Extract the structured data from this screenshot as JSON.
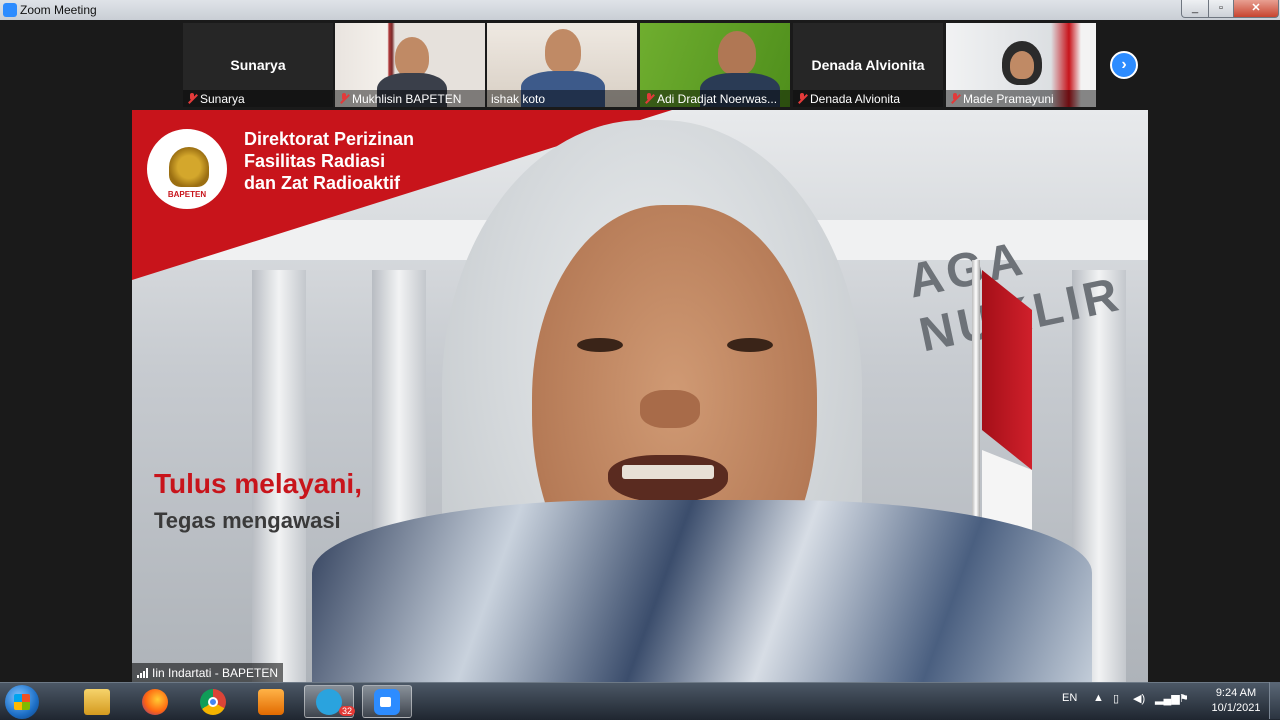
{
  "window": {
    "title": "Zoom Meeting",
    "minimize": "_",
    "maximize": "▫",
    "close": "✕"
  },
  "gallery": {
    "tiles": [
      {
        "name_center": "Sunarya",
        "caption": "Sunarya"
      },
      {
        "caption": "Mukhlisin BAPETEN"
      },
      {
        "caption": "ishak koto"
      },
      {
        "caption": "Adi Dradjat Noerwas..."
      },
      {
        "name_center": "Denada Alvionita",
        "caption": "Denada Alvionita"
      },
      {
        "caption": "Made Pramayuni"
      }
    ],
    "next_button": "›"
  },
  "main_video": {
    "banner_title_lines": [
      "Direktorat Perizinan",
      "Fasilitas Radiasi",
      "dan Zat Radioaktif"
    ],
    "logo_label": "BAPETEN",
    "slogan_line1": "Tulus melayani,",
    "slogan_line2": "Tegas mengawasi",
    "sign_text": "AGA NUKLIR",
    "speaker_name": "Iin Indartati - BAPETEN"
  },
  "taskbar": {
    "apps": [
      "explorer",
      "firefox",
      "chrome",
      "media-player",
      "telegram",
      "zoom"
    ],
    "telegram_badge": "32",
    "language": "EN",
    "time": "9:24 AM",
    "date": "10/1/2021"
  }
}
